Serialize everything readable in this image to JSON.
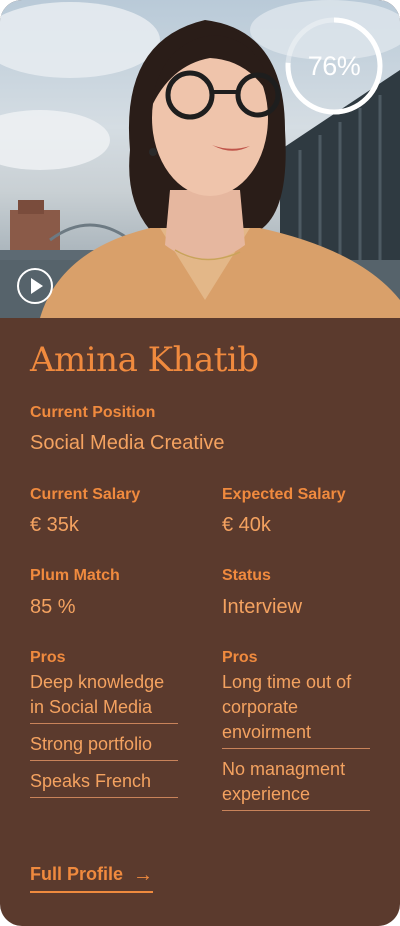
{
  "candidate": {
    "name": "Amina Khatib",
    "match_percent": "76%",
    "match_fraction": 0.76
  },
  "fields": {
    "current_position": {
      "label": "Current Position",
      "value": "Social Media Creative"
    },
    "current_salary": {
      "label": "Current Salary",
      "value": "€ 35k"
    },
    "expected_salary": {
      "label": "Expected Salary",
      "value": "€ 40k"
    },
    "plum_match": {
      "label": "Plum Match",
      "value": "85 %"
    },
    "status": {
      "label": "Status",
      "value": "Interview"
    }
  },
  "pros_left": {
    "label": "Pros",
    "items": [
      "Deep knowledge in Social Media",
      "Strong portfolio",
      "Speaks French"
    ]
  },
  "pros_right": {
    "label": "Pros",
    "items": [
      "Long time out of corporate envoirment",
      "No managment experience"
    ]
  },
  "actions": {
    "full_profile": "Full Profile",
    "arrow_icon": "arrow-right-icon",
    "play_icon": "play-icon"
  },
  "colors": {
    "card_background": "#5b3a2d",
    "accent": "#f08a3e",
    "value_text": "#f4a260"
  }
}
